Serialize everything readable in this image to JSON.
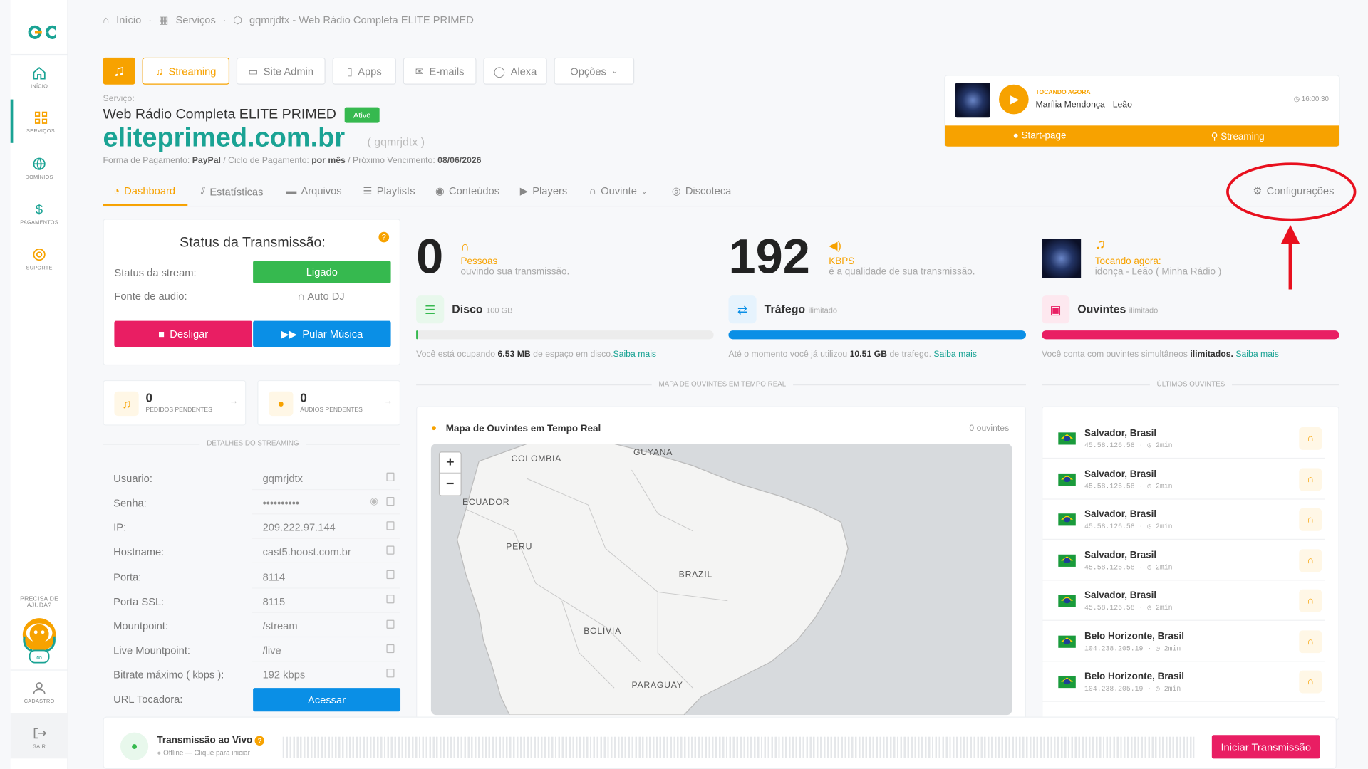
{
  "sidebar": {
    "items": [
      {
        "label": "INÍCIO"
      },
      {
        "label": "SERVIÇOS"
      },
      {
        "label": "DOMÍNIOS"
      },
      {
        "label": "PAGAMENTOS"
      },
      {
        "label": "SUPORTE"
      }
    ],
    "help": "PRECISA DE AJUDA?",
    "cadastro": "CADASTRO",
    "sair": "SAIR"
  },
  "breadcrumb": {
    "home": "Início",
    "services": "Serviços",
    "current": "gqmrjdtx - Web Rádio Completa ELITE PRIMED"
  },
  "nav": {
    "streaming": "Streaming",
    "site_admin": "Site Admin",
    "apps": "Apps",
    "emails": "E-mails",
    "alexa": "Alexa",
    "options": "Opções"
  },
  "service": {
    "label": "Serviço:",
    "name": "Web Rádio Completa ELITE PRIMED",
    "status": "Ativo",
    "domain": "eliteprimed.com.br",
    "code": "( gqmrjdtx )",
    "payment_label": "Forma de Pagamento:",
    "payment": "PayPal",
    "cycle_label": "/ Ciclo de Pagamento:",
    "cycle": "por mês",
    "due_label": "/ Próximo Vencimento:",
    "due": "08/06/2026"
  },
  "now_playing": {
    "label": "TOCANDO AGORA",
    "track": "Marília Mendonça - Leão",
    "time": "16:00:30",
    "start_page": "Start-page",
    "streaming": "Streaming"
  },
  "tabs": [
    "Dashboard",
    "Estatísticas",
    "Arquivos",
    "Playlists",
    "Conteúdos",
    "Players",
    "Ouvinte",
    "Discoteca"
  ],
  "config": "Configurações",
  "status_card": {
    "title": "Status da Transmissão:",
    "stream_label": "Status da stream:",
    "stream_value": "Ligado",
    "source_label": "Fonte de audio:",
    "source_value": "Auto DJ",
    "off_btn": "Desligar",
    "skip_btn": "Pular Música"
  },
  "pending": {
    "requests_count": "0",
    "requests_label": "PEDIDOS PENDENTES",
    "audios_count": "0",
    "audios_label": "ÁUDIOS PENDENTES"
  },
  "details_title": "DETALHES DO STREAMING",
  "details": [
    {
      "label": "Usuario:",
      "value": "gqmrjdtx"
    },
    {
      "label": "Senha:",
      "value": "••••••••••"
    },
    {
      "label": "IP:",
      "value": "209.222.97.144"
    },
    {
      "label": "Hostname:",
      "value": "cast5.hoost.com.br"
    },
    {
      "label": "Porta:",
      "value": "8114"
    },
    {
      "label": "Porta SSL:",
      "value": "8115"
    },
    {
      "label": "Mountpoint:",
      "value": "/stream"
    },
    {
      "label": "Live Mountpoint:",
      "value": "/live"
    },
    {
      "label": "Bitrate máximo ( kbps ):",
      "value": "192 kbps"
    },
    {
      "label": "URL Tocadora:",
      "value": "Acessar"
    }
  ],
  "stats": {
    "listeners": {
      "number": "0",
      "title": "Pessoas",
      "sub": "ouvindo sua transmissão."
    },
    "kbps": {
      "number": "192",
      "title": "KBPS",
      "sub": "é a qualidade de sua transmissão."
    },
    "playing": {
      "title": "Tocando agora:",
      "sub": "idonça - Leão ( Minha Rádio )"
    }
  },
  "usage": {
    "disk": {
      "title": "Disco",
      "cap": "100 GB",
      "pre": "Você está ocupando",
      "amount": "6.53 MB",
      "post": "de espaço em disco.",
      "link": "Saiba mais",
      "fill": 0.0001
    },
    "traffic": {
      "title": "Tráfego",
      "cap": "ilimitado",
      "pre": "Até o momento você já utilizou",
      "amount": "10.51 GB",
      "post": "de trafego.",
      "link": "Saiba mais",
      "fill": 1
    },
    "listeners": {
      "title": "Ouvintes",
      "cap": "ilimitado",
      "pre": "Você conta com ouvintes simultâneos",
      "amount": "ilimitados.",
      "link": "Saiba mais",
      "fill": 1
    }
  },
  "map_section_title": "MAPA DE OUVINTES EM TEMPO REAL",
  "last_section_title": "ÚLTIMOS OUVINTES",
  "map": {
    "title": "Mapa de Ouvintes em Tempo Real",
    "count": "0 ouvintes",
    "zoom_in": "+",
    "zoom_out": "−",
    "labels": [
      "COLOMBIA",
      "GUYANA",
      "ECUADOR",
      "PERU",
      "BRAZIL",
      "BOLIVIA",
      "PARAGUAY"
    ]
  },
  "listeners": [
    {
      "city": "Salvador, Brasil",
      "ip": "45.58.126.58",
      "time": "2min"
    },
    {
      "city": "Salvador, Brasil",
      "ip": "45.58.126.58",
      "time": "2min"
    },
    {
      "city": "Salvador, Brasil",
      "ip": "45.58.126.58",
      "time": "2min"
    },
    {
      "city": "Salvador, Brasil",
      "ip": "45.58.126.58",
      "time": "2min"
    },
    {
      "city": "Salvador, Brasil",
      "ip": "45.58.126.58",
      "time": "2min"
    },
    {
      "city": "Belo Horizonte, Brasil",
      "ip": "104.238.205.19",
      "time": "2min"
    },
    {
      "city": "Belo Horizonte, Brasil",
      "ip": "104.238.205.19",
      "time": "2min"
    }
  ],
  "live": {
    "title": "Transmissão ao Vivo",
    "status": "Offline — Clique para iniciar",
    "button": "Iniciar Transmissão"
  },
  "colors": {
    "accent": "#f7a200",
    "brand": "#1aa394",
    "green": "#36b94f",
    "pink": "#e91e63",
    "blue": "#0a8fe6",
    "annotation": "#e8101e"
  }
}
